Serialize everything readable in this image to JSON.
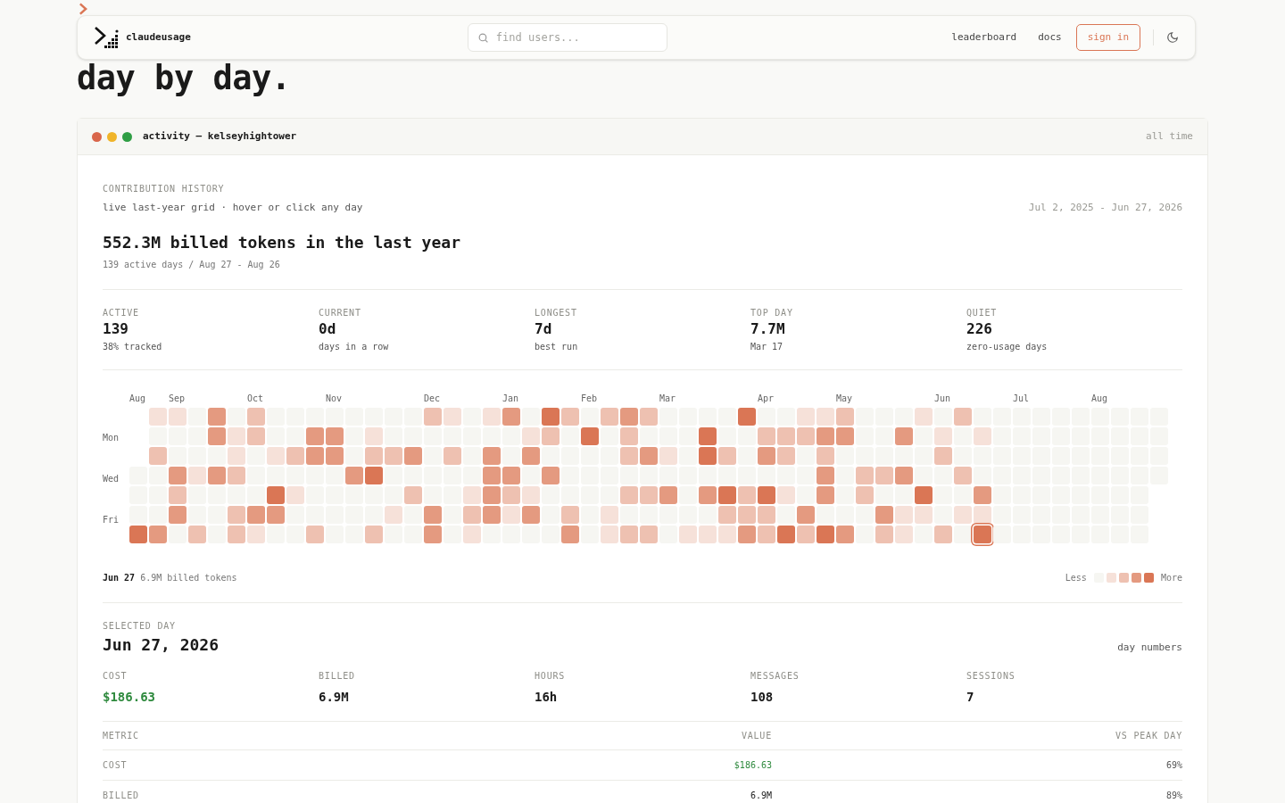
{
  "hero": {
    "lines": [
      "day by day."
    ]
  },
  "nav": {
    "brand": "claudeusage",
    "search": {
      "placeholder": "find users..."
    },
    "links": [
      "leaderboard",
      "docs"
    ],
    "sign_in": "sign in"
  },
  "card": {
    "title": "activity — kelseyhightower",
    "range": "all time"
  },
  "history": {
    "eyebrow": "CONTRIBUTION HISTORY",
    "subtitle": "live last-year grid · hover or click any day",
    "dates": "Jul 2, 2025 - Jun 27, 2026",
    "headline": "552.3M billed tokens in the last year",
    "summary": "139 active days / Aug 27 - Aug 26"
  },
  "stats": [
    {
      "label": "ACTIVE",
      "value": "139",
      "note": "38% tracked"
    },
    {
      "label": "CURRENT",
      "value": "0d",
      "note": "days in a row"
    },
    {
      "label": "LONGEST",
      "value": "7d",
      "note": "best run"
    },
    {
      "label": "TOP DAY",
      "value": "7.7M",
      "note": "Mar 17"
    },
    {
      "label": "QUIET",
      "value": "226",
      "note": "zero-usage days"
    }
  ],
  "weekdays": [
    "Mon",
    "Wed",
    "Fri"
  ],
  "weeks": [
    {
      "month": "Aug",
      "days": [
        {
          "color": "#f6f6f2",
          "selected": false
        },
        {
          "color": "#f6f6f2",
          "selected": false
        },
        {
          "color": "#f6f6f2",
          "selected": false
        },
        {
          "color": "#da7655",
          "selected": false
        }
      ]
    },
    {
      "days": [
        {
          "color": "#f6e1d9",
          "selected": false
        },
        {
          "color": "#f6f6f2",
          "selected": false
        },
        {
          "color": "#eec1b1",
          "selected": false
        },
        {
          "color": "#f6f6f2",
          "selected": false
        },
        {
          "color": "#f6f6f2",
          "selected": false
        },
        {
          "color": "#f6f6f2",
          "selected": false
        },
        {
          "color": "#e49a80",
          "selected": false
        }
      ]
    },
    {
      "month": "Sep",
      "days": [
        {
          "color": "#f6e1d9",
          "selected": false
        },
        {
          "color": "#f6f6f2",
          "selected": false
        },
        {
          "color": "#f6f6f2",
          "selected": false
        },
        {
          "color": "#e49a80",
          "selected": false
        },
        {
          "color": "#eec1b1",
          "selected": false
        },
        {
          "color": "#e49a80",
          "selected": false
        },
        {
          "color": "#f6f6f2",
          "selected": false
        }
      ]
    },
    {
      "days": [
        {
          "color": "#f6f6f2",
          "selected": false
        },
        {
          "color": "#f6f6f2",
          "selected": false
        },
        {
          "color": "#f6f6f2",
          "selected": false
        },
        {
          "color": "#f6e1d9",
          "selected": false
        },
        {
          "color": "#f6f6f2",
          "selected": false
        },
        {
          "color": "#f6f6f2",
          "selected": false
        },
        {
          "color": "#eec1b1",
          "selected": false
        }
      ]
    },
    {
      "days": [
        {
          "color": "#e49a80",
          "selected": false
        },
        {
          "color": "#e49a80",
          "selected": false
        },
        {
          "color": "#f6f6f2",
          "selected": false
        },
        {
          "color": "#e49a80",
          "selected": false
        },
        {
          "color": "#f6f6f2",
          "selected": false
        },
        {
          "color": "#f6f6f2",
          "selected": false
        },
        {
          "color": "#f6f6f2",
          "selected": false
        }
      ]
    },
    {
      "days": [
        {
          "color": "#f6f6f2",
          "selected": false
        },
        {
          "color": "#f6e1d9",
          "selected": false
        },
        {
          "color": "#f6e1d9",
          "selected": false
        },
        {
          "color": "#eec1b1",
          "selected": false
        },
        {
          "color": "#f6f6f2",
          "selected": false
        },
        {
          "color": "#eec1b1",
          "selected": false
        },
        {
          "color": "#eec1b1",
          "selected": false
        }
      ]
    },
    {
      "month": "Oct",
      "days": [
        {
          "color": "#eec1b1",
          "selected": false
        },
        {
          "color": "#eec1b1",
          "selected": false
        },
        {
          "color": "#f6f6f2",
          "selected": false
        },
        {
          "color": "#f6f6f2",
          "selected": false
        },
        {
          "color": "#f6f6f2",
          "selected": false
        },
        {
          "color": "#e49a80",
          "selected": false
        },
        {
          "color": "#f6e1d9",
          "selected": false
        }
      ]
    },
    {
      "days": [
        {
          "color": "#f6f6f2",
          "selected": false
        },
        {
          "color": "#f6f6f2",
          "selected": false
        },
        {
          "color": "#f6e1d9",
          "selected": false
        },
        {
          "color": "#f6f6f2",
          "selected": false
        },
        {
          "color": "#da7655",
          "selected": false
        },
        {
          "color": "#e49a80",
          "selected": false
        },
        {
          "color": "#f6f6f2",
          "selected": false
        }
      ]
    },
    {
      "days": [
        {
          "color": "#f6f6f2",
          "selected": false
        },
        {
          "color": "#f6f6f2",
          "selected": false
        },
        {
          "color": "#eec1b1",
          "selected": false
        },
        {
          "color": "#f6f6f2",
          "selected": false
        },
        {
          "color": "#f6e1d9",
          "selected": false
        },
        {
          "color": "#f6f6f2",
          "selected": false
        },
        {
          "color": "#f6f6f2",
          "selected": false
        }
      ]
    },
    {
      "days": [
        {
          "color": "#f6f6f2",
          "selected": false
        },
        {
          "color": "#e49a80",
          "selected": false
        },
        {
          "color": "#e49a80",
          "selected": false
        },
        {
          "color": "#f6f6f2",
          "selected": false
        },
        {
          "color": "#f6f6f2",
          "selected": false
        },
        {
          "color": "#f6f6f2",
          "selected": false
        },
        {
          "color": "#eec1b1",
          "selected": false
        }
      ]
    },
    {
      "month": "Nov",
      "days": [
        {
          "color": "#f6f6f2",
          "selected": false
        },
        {
          "color": "#e49a80",
          "selected": false
        },
        {
          "color": "#e49a80",
          "selected": false
        },
        {
          "color": "#f6f6f2",
          "selected": false
        },
        {
          "color": "#f6f6f2",
          "selected": false
        },
        {
          "color": "#f6f6f2",
          "selected": false
        },
        {
          "color": "#f6f6f2",
          "selected": false
        }
      ]
    },
    {
      "days": [
        {
          "color": "#f6f6f2",
          "selected": false
        },
        {
          "color": "#f6f6f2",
          "selected": false
        },
        {
          "color": "#f6f6f2",
          "selected": false
        },
        {
          "color": "#e49a80",
          "selected": false
        },
        {
          "color": "#f6f6f2",
          "selected": false
        },
        {
          "color": "#f6f6f2",
          "selected": false
        },
        {
          "color": "#f6f6f2",
          "selected": false
        }
      ]
    },
    {
      "days": [
        {
          "color": "#f6f6f2",
          "selected": false
        },
        {
          "color": "#f6e1d9",
          "selected": false
        },
        {
          "color": "#eec1b1",
          "selected": false
        },
        {
          "color": "#da7655",
          "selected": false
        },
        {
          "color": "#f6f6f2",
          "selected": false
        },
        {
          "color": "#f6f6f2",
          "selected": false
        },
        {
          "color": "#eec1b1",
          "selected": false
        }
      ]
    },
    {
      "days": [
        {
          "color": "#f6f6f2",
          "selected": false
        },
        {
          "color": "#f6f6f2",
          "selected": false
        },
        {
          "color": "#eec1b1",
          "selected": false
        },
        {
          "color": "#f6f6f2",
          "selected": false
        },
        {
          "color": "#f6f6f2",
          "selected": false
        },
        {
          "color": "#f6e1d9",
          "selected": false
        },
        {
          "color": "#f6f6f2",
          "selected": false
        }
      ]
    },
    {
      "days": [
        {
          "color": "#f6f6f2",
          "selected": false
        },
        {
          "color": "#f6f6f2",
          "selected": false
        },
        {
          "color": "#e49a80",
          "selected": false
        },
        {
          "color": "#f6f6f2",
          "selected": false
        },
        {
          "color": "#eec1b1",
          "selected": false
        },
        {
          "color": "#f6f6f2",
          "selected": false
        },
        {
          "color": "#f6f6f2",
          "selected": false
        }
      ]
    },
    {
      "month": "Dec",
      "days": [
        {
          "color": "#eec1b1",
          "selected": false
        },
        {
          "color": "#f6f6f2",
          "selected": false
        },
        {
          "color": "#f6f6f2",
          "selected": false
        },
        {
          "color": "#f6f6f2",
          "selected": false
        },
        {
          "color": "#f6f6f2",
          "selected": false
        },
        {
          "color": "#e49a80",
          "selected": false
        },
        {
          "color": "#e49a80",
          "selected": false
        }
      ]
    },
    {
      "days": [
        {
          "color": "#f6e1d9",
          "selected": false
        },
        {
          "color": "#f6f6f2",
          "selected": false
        },
        {
          "color": "#eec1b1",
          "selected": false
        },
        {
          "color": "#f6f6f2",
          "selected": false
        },
        {
          "color": "#f6f6f2",
          "selected": false
        },
        {
          "color": "#f6f6f2",
          "selected": false
        },
        {
          "color": "#f6f6f2",
          "selected": false
        }
      ]
    },
    {
      "days": [
        {
          "color": "#f6f6f2",
          "selected": false
        },
        {
          "color": "#f6f6f2",
          "selected": false
        },
        {
          "color": "#f6f6f2",
          "selected": false
        },
        {
          "color": "#f6f6f2",
          "selected": false
        },
        {
          "color": "#f6e1d9",
          "selected": false
        },
        {
          "color": "#eec1b1",
          "selected": false
        },
        {
          "color": "#f6e1d9",
          "selected": false
        }
      ]
    },
    {
      "days": [
        {
          "color": "#f6e1d9",
          "selected": false
        },
        {
          "color": "#f6f6f2",
          "selected": false
        },
        {
          "color": "#e49a80",
          "selected": false
        },
        {
          "color": "#e49a80",
          "selected": false
        },
        {
          "color": "#e49a80",
          "selected": false
        },
        {
          "color": "#e49a80",
          "selected": false
        },
        {
          "color": "#f6f6f2",
          "selected": false
        }
      ]
    },
    {
      "month": "Jan",
      "days": [
        {
          "color": "#e49a80",
          "selected": false
        },
        {
          "color": "#f6f6f2",
          "selected": false
        },
        {
          "color": "#f6f6f2",
          "selected": false
        },
        {
          "color": "#e49a80",
          "selected": false
        },
        {
          "color": "#eec1b1",
          "selected": false
        },
        {
          "color": "#f6e1d9",
          "selected": false
        },
        {
          "color": "#f6f6f2",
          "selected": false
        }
      ]
    },
    {
      "days": [
        {
          "color": "#f6f6f2",
          "selected": false
        },
        {
          "color": "#f6e1d9",
          "selected": false
        },
        {
          "color": "#e49a80",
          "selected": false
        },
        {
          "color": "#f6f6f2",
          "selected": false
        },
        {
          "color": "#f6e1d9",
          "selected": false
        },
        {
          "color": "#e49a80",
          "selected": false
        },
        {
          "color": "#f6f6f2",
          "selected": false
        }
      ]
    },
    {
      "days": [
        {
          "color": "#da7655",
          "selected": false
        },
        {
          "color": "#eec1b1",
          "selected": false
        },
        {
          "color": "#f6f6f2",
          "selected": false
        },
        {
          "color": "#e49a80",
          "selected": false
        },
        {
          "color": "#f6f6f2",
          "selected": false
        },
        {
          "color": "#f6f6f2",
          "selected": false
        },
        {
          "color": "#f6f6f2",
          "selected": false
        }
      ]
    },
    {
      "days": [
        {
          "color": "#eec1b1",
          "selected": false
        },
        {
          "color": "#f6f6f2",
          "selected": false
        },
        {
          "color": "#f6f6f2",
          "selected": false
        },
        {
          "color": "#f6f6f2",
          "selected": false
        },
        {
          "color": "#f6f6f2",
          "selected": false
        },
        {
          "color": "#eec1b1",
          "selected": false
        },
        {
          "color": "#e49a80",
          "selected": false
        }
      ]
    },
    {
      "month": "Feb",
      "days": [
        {
          "color": "#f6f6f2",
          "selected": false
        },
        {
          "color": "#da7655",
          "selected": false
        },
        {
          "color": "#f6f6f2",
          "selected": false
        },
        {
          "color": "#f6f6f2",
          "selected": false
        },
        {
          "color": "#f6f6f2",
          "selected": false
        },
        {
          "color": "#f6f6f2",
          "selected": false
        },
        {
          "color": "#f6f6f2",
          "selected": false
        }
      ]
    },
    {
      "days": [
        {
          "color": "#eec1b1",
          "selected": false
        },
        {
          "color": "#f6f6f2",
          "selected": false
        },
        {
          "color": "#f6f6f2",
          "selected": false
        },
        {
          "color": "#f6f6f2",
          "selected": false
        },
        {
          "color": "#f6f6f2",
          "selected": false
        },
        {
          "color": "#f6e1d9",
          "selected": false
        },
        {
          "color": "#f6e1d9",
          "selected": false
        }
      ]
    },
    {
      "days": [
        {
          "color": "#e49a80",
          "selected": false
        },
        {
          "color": "#eec1b1",
          "selected": false
        },
        {
          "color": "#eec1b1",
          "selected": false
        },
        {
          "color": "#f6f6f2",
          "selected": false
        },
        {
          "color": "#eec1b1",
          "selected": false
        },
        {
          "color": "#f6f6f2",
          "selected": false
        },
        {
          "color": "#eec1b1",
          "selected": false
        }
      ]
    },
    {
      "days": [
        {
          "color": "#eec1b1",
          "selected": false
        },
        {
          "color": "#f6f6f2",
          "selected": false
        },
        {
          "color": "#e49a80",
          "selected": false
        },
        {
          "color": "#f6f6f2",
          "selected": false
        },
        {
          "color": "#eec1b1",
          "selected": false
        },
        {
          "color": "#f6f6f2",
          "selected": false
        },
        {
          "color": "#eec1b1",
          "selected": false
        }
      ]
    },
    {
      "month": "Mar",
      "days": [
        {
          "color": "#f6f6f2",
          "selected": false
        },
        {
          "color": "#f6f6f2",
          "selected": false
        },
        {
          "color": "#f6e1d9",
          "selected": false
        },
        {
          "color": "#f6f6f2",
          "selected": false
        },
        {
          "color": "#e49a80",
          "selected": false
        },
        {
          "color": "#f6f6f2",
          "selected": false
        },
        {
          "color": "#f6f6f2",
          "selected": false
        }
      ]
    },
    {
      "days": [
        {
          "color": "#f6f6f2",
          "selected": false
        },
        {
          "color": "#f6f6f2",
          "selected": false
        },
        {
          "color": "#f6f6f2",
          "selected": false
        },
        {
          "color": "#f6f6f2",
          "selected": false
        },
        {
          "color": "#f6f6f2",
          "selected": false
        },
        {
          "color": "#f6f6f2",
          "selected": false
        },
        {
          "color": "#f6e1d9",
          "selected": false
        }
      ]
    },
    {
      "days": [
        {
          "color": "#f6f6f2",
          "selected": false
        },
        {
          "color": "#da7655",
          "selected": false
        },
        {
          "color": "#da7655",
          "selected": false
        },
        {
          "color": "#f6f6f2",
          "selected": false
        },
        {
          "color": "#e49a80",
          "selected": false
        },
        {
          "color": "#f6f6f2",
          "selected": false
        },
        {
          "color": "#f6e1d9",
          "selected": false
        }
      ]
    },
    {
      "days": [
        {
          "color": "#f6f6f2",
          "selected": false
        },
        {
          "color": "#f6f6f2",
          "selected": false
        },
        {
          "color": "#eec1b1",
          "selected": false
        },
        {
          "color": "#f6f6f2",
          "selected": false
        },
        {
          "color": "#da7655",
          "selected": false
        },
        {
          "color": "#eec1b1",
          "selected": false
        },
        {
          "color": "#f6e1d9",
          "selected": false
        }
      ]
    },
    {
      "days": [
        {
          "color": "#da7655",
          "selected": false
        },
        {
          "color": "#f6f6f2",
          "selected": false
        },
        {
          "color": "#f6f6f2",
          "selected": false
        },
        {
          "color": "#f6f6f2",
          "selected": false
        },
        {
          "color": "#eec1b1",
          "selected": false
        },
        {
          "color": "#eec1b1",
          "selected": false
        },
        {
          "color": "#e49a80",
          "selected": false
        }
      ]
    },
    {
      "month": "Apr",
      "days": [
        {
          "color": "#f6f6f2",
          "selected": false
        },
        {
          "color": "#eec1b1",
          "selected": false
        },
        {
          "color": "#e49a80",
          "selected": false
        },
        {
          "color": "#f6f6f2",
          "selected": false
        },
        {
          "color": "#da7655",
          "selected": false
        },
        {
          "color": "#eec1b1",
          "selected": false
        },
        {
          "color": "#eec1b1",
          "selected": false
        }
      ]
    },
    {
      "days": [
        {
          "color": "#f6f6f2",
          "selected": false
        },
        {
          "color": "#eec1b1",
          "selected": false
        },
        {
          "color": "#eec1b1",
          "selected": false
        },
        {
          "color": "#f6f6f2",
          "selected": false
        },
        {
          "color": "#f6e1d9",
          "selected": false
        },
        {
          "color": "#f6f6f2",
          "selected": false
        },
        {
          "color": "#da7655",
          "selected": false
        }
      ]
    },
    {
      "days": [
        {
          "color": "#f6e1d9",
          "selected": false
        },
        {
          "color": "#eec1b1",
          "selected": false
        },
        {
          "color": "#f6f6f2",
          "selected": false
        },
        {
          "color": "#f6f6f2",
          "selected": false
        },
        {
          "color": "#f6f6f2",
          "selected": false
        },
        {
          "color": "#e49a80",
          "selected": false
        },
        {
          "color": "#eec1b1",
          "selected": false
        }
      ]
    },
    {
      "days": [
        {
          "color": "#f6e1d9",
          "selected": false
        },
        {
          "color": "#e49a80",
          "selected": false
        },
        {
          "color": "#eec1b1",
          "selected": false
        },
        {
          "color": "#e49a80",
          "selected": false
        },
        {
          "color": "#e49a80",
          "selected": false
        },
        {
          "color": "#f6f6f2",
          "selected": false
        },
        {
          "color": "#da7655",
          "selected": false
        }
      ]
    },
    {
      "month": "May",
      "days": [
        {
          "color": "#eec1b1",
          "selected": false
        },
        {
          "color": "#e49a80",
          "selected": false
        },
        {
          "color": "#f6f6f2",
          "selected": false
        },
        {
          "color": "#f6f6f2",
          "selected": false
        },
        {
          "color": "#f6f6f2",
          "selected": false
        },
        {
          "color": "#f6f6f2",
          "selected": false
        },
        {
          "color": "#e49a80",
          "selected": false
        }
      ]
    },
    {
      "days": [
        {
          "color": "#f6f6f2",
          "selected": false
        },
        {
          "color": "#f6f6f2",
          "selected": false
        },
        {
          "color": "#f6f6f2",
          "selected": false
        },
        {
          "color": "#eec1b1",
          "selected": false
        },
        {
          "color": "#eec1b1",
          "selected": false
        },
        {
          "color": "#f6f6f2",
          "selected": false
        },
        {
          "color": "#f6f6f2",
          "selected": false
        }
      ]
    },
    {
      "days": [
        {
          "color": "#f6f6f2",
          "selected": false
        },
        {
          "color": "#f6f6f2",
          "selected": false
        },
        {
          "color": "#f6f6f2",
          "selected": false
        },
        {
          "color": "#eec1b1",
          "selected": false
        },
        {
          "color": "#f6f6f2",
          "selected": false
        },
        {
          "color": "#e49a80",
          "selected": false
        },
        {
          "color": "#eec1b1",
          "selected": false
        }
      ]
    },
    {
      "days": [
        {
          "color": "#f6f6f2",
          "selected": false
        },
        {
          "color": "#e49a80",
          "selected": false
        },
        {
          "color": "#f6f6f2",
          "selected": false
        },
        {
          "color": "#e49a80",
          "selected": false
        },
        {
          "color": "#f6f6f2",
          "selected": false
        },
        {
          "color": "#f6e1d9",
          "selected": false
        },
        {
          "color": "#f6e1d9",
          "selected": false
        }
      ]
    },
    {
      "days": [
        {
          "color": "#f6e1d9",
          "selected": false
        },
        {
          "color": "#f6f6f2",
          "selected": false
        },
        {
          "color": "#f6f6f2",
          "selected": false
        },
        {
          "color": "#f6f6f2",
          "selected": false
        },
        {
          "color": "#da7655",
          "selected": false
        },
        {
          "color": "#f6e1d9",
          "selected": false
        },
        {
          "color": "#f6f6f2",
          "selected": false
        }
      ]
    },
    {
      "month": "Jun",
      "days": [
        {
          "color": "#f6f6f2",
          "selected": false
        },
        {
          "color": "#f6e1d9",
          "selected": false
        },
        {
          "color": "#eec1b1",
          "selected": false
        },
        {
          "color": "#f6f6f2",
          "selected": false
        },
        {
          "color": "#f6f6f2",
          "selected": false
        },
        {
          "color": "#f6f6f2",
          "selected": false
        },
        {
          "color": "#eec1b1",
          "selected": false
        }
      ]
    },
    {
      "days": [
        {
          "color": "#eec1b1",
          "selected": false
        },
        {
          "color": "#f6f6f2",
          "selected": false
        },
        {
          "color": "#f6f6f2",
          "selected": false
        },
        {
          "color": "#eec1b1",
          "selected": false
        },
        {
          "color": "#f6f6f2",
          "selected": false
        },
        {
          "color": "#f6e1d9",
          "selected": false
        },
        {
          "color": "#f6f6f2",
          "selected": false
        }
      ]
    },
    {
      "days": [
        {
          "color": "#f6f6f2",
          "selected": false
        },
        {
          "color": "#f6e1d9",
          "selected": false
        },
        {
          "color": "#f6f6f2",
          "selected": false
        },
        {
          "color": "#f6f6f2",
          "selected": false
        },
        {
          "color": "#e49a80",
          "selected": false
        },
        {
          "color": "#f6e1d9",
          "selected": false
        },
        {
          "color": "#da7655",
          "selected": true
        }
      ]
    },
    {
      "days": [
        {
          "color": "#f6f6f2",
          "selected": false
        },
        {
          "color": "#f6f6f2",
          "selected": false
        },
        {
          "color": "#f6f6f2",
          "selected": false
        },
        {
          "color": "#f6f6f2",
          "selected": false
        },
        {
          "color": "#f6f6f2",
          "selected": false
        },
        {
          "color": "#f6f6f2",
          "selected": false
        },
        {
          "color": "#f6f6f2",
          "selected": false
        }
      ]
    },
    {
      "month": "Jul",
      "days": [
        {
          "color": "#f6f6f2",
          "selected": false
        },
        {
          "color": "#f6f6f2",
          "selected": false
        },
        {
          "color": "#f6f6f2",
          "selected": false
        },
        {
          "color": "#f6f6f2",
          "selected": false
        },
        {
          "color": "#f6f6f2",
          "selected": false
        },
        {
          "color": "#f6f6f2",
          "selected": false
        },
        {
          "color": "#f6f6f2",
          "selected": false
        }
      ]
    },
    {
      "days": [
        {
          "color": "#f6f6f2",
          "selected": false
        },
        {
          "color": "#f6f6f2",
          "selected": false
        },
        {
          "color": "#f6f6f2",
          "selected": false
        },
        {
          "color": "#f6f6f2",
          "selected": false
        },
        {
          "color": "#f6f6f2",
          "selected": false
        },
        {
          "color": "#f6f6f2",
          "selected": false
        },
        {
          "color": "#f6f6f2",
          "selected": false
        }
      ]
    },
    {
      "days": [
        {
          "color": "#f6f6f2",
          "selected": false
        },
        {
          "color": "#f6f6f2",
          "selected": false
        },
        {
          "color": "#f6f6f2",
          "selected": false
        },
        {
          "color": "#f6f6f2",
          "selected": false
        },
        {
          "color": "#f6f6f2",
          "selected": false
        },
        {
          "color": "#f6f6f2",
          "selected": false
        },
        {
          "color": "#f6f6f2",
          "selected": false
        }
      ]
    },
    {
      "days": [
        {
          "color": "#f6f6f2",
          "selected": false
        },
        {
          "color": "#f6f6f2",
          "selected": false
        },
        {
          "color": "#f6f6f2",
          "selected": false
        },
        {
          "color": "#f6f6f2",
          "selected": false
        },
        {
          "color": "#f6f6f2",
          "selected": false
        },
        {
          "color": "#f6f6f2",
          "selected": false
        },
        {
          "color": "#f6f6f2",
          "selected": false
        }
      ]
    },
    {
      "month": "Aug",
      "days": [
        {
          "color": "#f6f6f2",
          "selected": false
        },
        {
          "color": "#f6f6f2",
          "selected": false
        },
        {
          "color": "#f6f6f2",
          "selected": false
        },
        {
          "color": "#f6f6f2",
          "selected": false
        },
        {
          "color": "#f6f6f2",
          "selected": false
        },
        {
          "color": "#f6f6f2",
          "selected": false
        },
        {
          "color": "#f6f6f2",
          "selected": false
        }
      ]
    },
    {
      "days": [
        {
          "color": "#f6f6f2",
          "selected": false
        },
        {
          "color": "#f6f6f2",
          "selected": false
        },
        {
          "color": "#f6f6f2",
          "selected": false
        },
        {
          "color": "#f6f6f2",
          "selected": false
        },
        {
          "color": "#f6f6f2",
          "selected": false
        },
        {
          "color": "#f6f6f2",
          "selected": false
        },
        {
          "color": "#f6f6f2",
          "selected": false
        }
      ]
    },
    {
      "days": [
        {
          "color": "#f6f6f2",
          "selected": false
        },
        {
          "color": "#f6f6f2",
          "selected": false
        },
        {
          "color": "#f6f6f2",
          "selected": false
        },
        {
          "color": "#f6f6f2",
          "selected": false
        },
        {
          "color": "#f6f6f2",
          "selected": false
        },
        {
          "color": "#f6f6f2",
          "selected": false
        },
        {
          "color": "#f6f6f2",
          "selected": false
        }
      ]
    },
    {
      "days": [
        {
          "color": "#f6f6f2",
          "selected": false
        },
        {
          "color": "#f6f6f2",
          "selected": false
        },
        {
          "color": "#f6f6f2",
          "selected": false
        },
        {
          "color": "#f6f6f2",
          "selected": false
        }
      ]
    }
  ],
  "grid_footer": {
    "date": "Jun 27",
    "detail": "6.9M billed tokens",
    "less": "Less",
    "more": "More"
  },
  "selected_day": {
    "eyebrow": "SELECTED DAY",
    "date": "Jun 27, 2026",
    "toggle": "day numbers"
  },
  "day_metrics": [
    {
      "label": "COST",
      "value": "$186.63",
      "kind": "money"
    },
    {
      "label": "BILLED",
      "value": "6.9M",
      "kind": "count"
    },
    {
      "label": "HOURS",
      "value": "16h",
      "kind": "count"
    },
    {
      "label": "MESSAGES",
      "value": "108",
      "kind": "count"
    },
    {
      "label": "SESSIONS",
      "value": "7",
      "kind": "count"
    }
  ],
  "table": {
    "columns": [
      "METRIC",
      "VALUE",
      "VS PEAK DAY"
    ],
    "rows": [
      {
        "metric": "COST",
        "value": "$186.63",
        "peak": "69%",
        "kind": "money"
      },
      {
        "metric": "BILLED",
        "value": "6.9M",
        "peak": "89%",
        "kind": "count"
      }
    ]
  }
}
